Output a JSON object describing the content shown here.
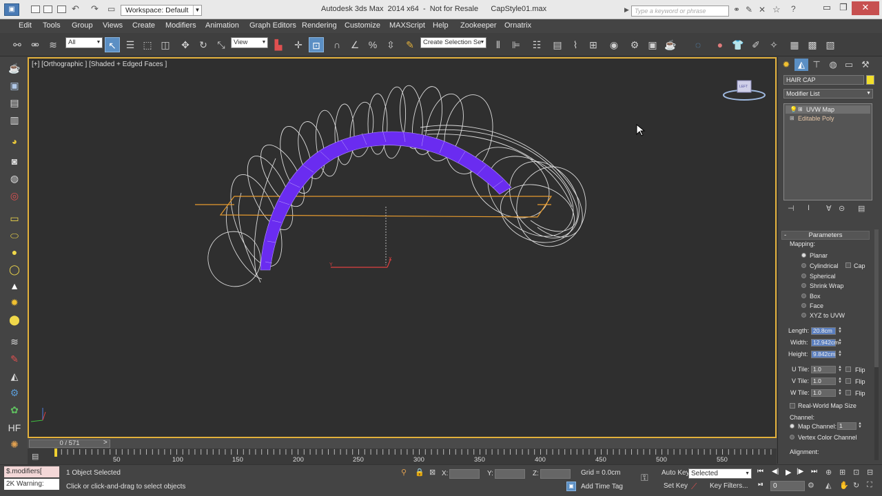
{
  "window": {
    "title": "Autodesk 3ds Max  2014 x64  -  Not for Resale      CapStyle01.max",
    "workspace_value": "Workspace: Default",
    "search_placeholder": "Type a keyword or phrase"
  },
  "menu": [
    "Edit",
    "Tools",
    "Group",
    "Views",
    "Create",
    "Modifiers",
    "Animation",
    "Graph Editors",
    "Rendering",
    "Customize",
    "MAXScript",
    "Help",
    "Zookeeper",
    "Ornatrix"
  ],
  "toolbar": {
    "filter_value": "All",
    "refcoord_value": "View",
    "selection_set_value": "Create Selection Se"
  },
  "viewport": {
    "label": "[+] [Orthographic ] [Shaded + Edged Faces ]",
    "viewcube_label": "LEFT",
    "colors": {
      "border": "#e3b13b",
      "mesh": "#6a2cf0",
      "hair": "#f0f0f0",
      "gizmo": "#e79b2f"
    }
  },
  "timeline": {
    "slider": "0 / 571",
    "prev": "<",
    "next": ">",
    "ticks": [
      "50",
      "100",
      "150",
      "200",
      "250",
      "300",
      "350",
      "400",
      "450",
      "500",
      "550"
    ]
  },
  "status": {
    "script_line1": "$.modifiers[",
    "script_line2": "2K Warning:",
    "selected": "1 Object Selected",
    "prompt": "Click or click-and-drag to select objects",
    "x_label": "X:",
    "y_label": "Y:",
    "z_label": "Z:",
    "grid": "Grid = 0.0cm",
    "add_time_tag": "Add Time Tag",
    "auto_key": "Auto Key",
    "auto_key_value": "Selected",
    "set_key": "Set Key",
    "key_filters": "Key Filters...",
    "frame_value": "0"
  },
  "command_panel": {
    "object_name": "HAIR CAP",
    "object_color": "#f2df2a",
    "modifier_list": "Modifier List",
    "stack": [
      "UVW Map",
      "Editable Poly"
    ],
    "rollout_title": "Parameters",
    "mapping_label": "Mapping:",
    "mapping_options": [
      "Planar",
      "Cylindrical",
      "Spherical",
      "Shrink Wrap",
      "Box",
      "Face",
      "XYZ to UVW"
    ],
    "cap_label": "Cap",
    "length_label": "Length:",
    "length_value": "20.8cm",
    "width_label": "Width:",
    "width_value": "12.942cm",
    "height_label": "Height:",
    "height_value": "9.842cm",
    "u_tile_label": "U Tile:",
    "u_tile_value": "1.0",
    "v_tile_label": "V Tile:",
    "v_tile_value": "1.0",
    "w_tile_label": "W Tile:",
    "w_tile_value": "1.0",
    "flip_label": "Flip",
    "real_world_label": "Real-World Map Size",
    "channel_label": "Channel:",
    "map_channel_label": "Map Channel:",
    "map_channel_value": "1",
    "vertex_color_label": "Vertex Color Channel",
    "alignment_label": "Alignment:"
  }
}
